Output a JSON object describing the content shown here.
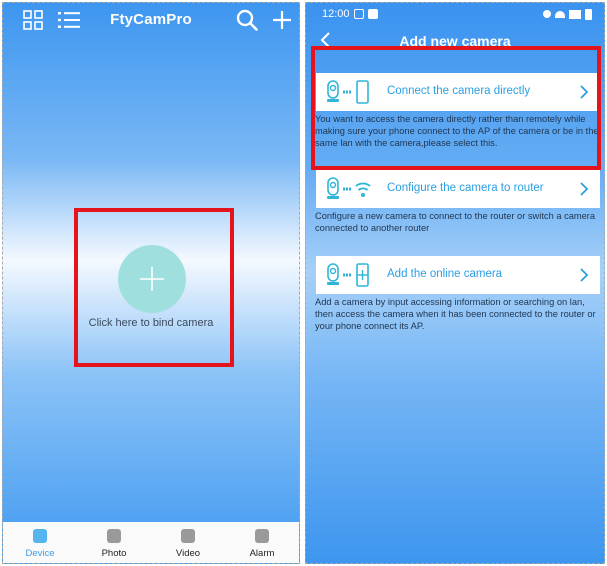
{
  "left_screen": {
    "app_title": "FtyCamPro",
    "bind_label": "Click here to bind camera",
    "tabs": [
      {
        "label": "Device",
        "icon": "device-icon",
        "active": true
      },
      {
        "label": "Photo",
        "icon": "photo-icon",
        "active": false
      },
      {
        "label": "Video",
        "icon": "video-icon",
        "active": false
      },
      {
        "label": "Alarm",
        "icon": "alarm-icon",
        "active": false
      }
    ]
  },
  "right_screen": {
    "status": {
      "time": "12:00"
    },
    "header_title": "Add new camera",
    "options": [
      {
        "label": "Connect the camera directly",
        "icon": "phone-icon",
        "description": "You want to access the camera directly rather than remotely while making sure your phone connect to the AP of the camera or be in the same lan with the camera,please select this."
      },
      {
        "label": "Configure the camera to router",
        "icon": "wifi-icon",
        "description": "Configure a new camera to connect to the router or switch a camera connected to another router"
      },
      {
        "label": "Add the online camera",
        "icon": "add-device-icon",
        "description": "Add a camera by input accessing information or searching on lan, then access the camera when it has been connected to the router or your phone connect its AP."
      }
    ]
  },
  "colors": {
    "highlight": "#e5141b",
    "accent": "#2a9fe2",
    "active_tab": "#3f9ae8",
    "bind_circle": "#9fe0de"
  }
}
